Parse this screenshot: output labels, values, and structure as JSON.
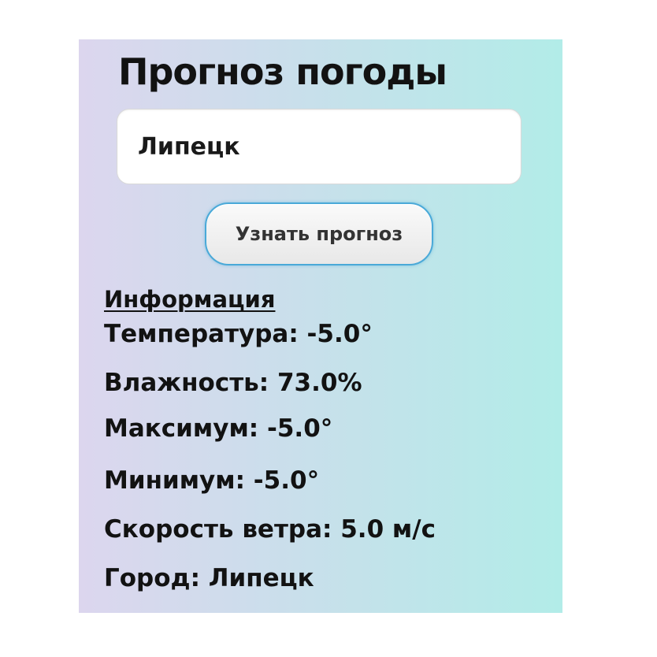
{
  "header": {
    "title": "Прогноз погоды"
  },
  "search": {
    "city_value": "Липецк"
  },
  "actions": {
    "forecast_button_label": "Узнать прогноз"
  },
  "info": {
    "heading": "Информация",
    "rows": [
      "Температура: -5.0°",
      "Влажность: 73.0%",
      "Максимум: -5.0°",
      "Минимум: -5.0°",
      "Скорость ветра: 5.0 м/с",
      "Город: Липецк"
    ]
  },
  "colors": {
    "gradient_left": "#dcd6ee",
    "gradient_right": "#b2ece8",
    "button_border": "#4aa9d8",
    "text": "#121212"
  }
}
